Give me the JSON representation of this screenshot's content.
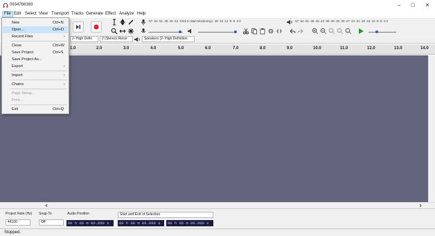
{
  "window": {
    "title": "0934766383",
    "minimize": "–",
    "maximize": "▢",
    "close": "✕"
  },
  "menubar": {
    "items": [
      "File",
      "Edit",
      "Select",
      "View",
      "Transport",
      "Tracks",
      "Generate",
      "Effect",
      "Analyze",
      "Help"
    ]
  },
  "file_menu": {
    "items": [
      {
        "label": "New",
        "shortcut": "Ctrl+N"
      },
      {
        "label": "Open...",
        "shortcut": "Ctrl+O"
      },
      {
        "label": "Recent Files",
        "arrow": "›"
      },
      {
        "label": "Close",
        "shortcut": "Ctrl+W"
      },
      {
        "label": "Save Project",
        "shortcut": "Ctrl+S"
      },
      {
        "label": "Save Project As..."
      },
      {
        "label": "Export",
        "arrow": "›"
      },
      {
        "label": "Import",
        "arrow": "›"
      },
      {
        "label": "Chains",
        "arrow": "›"
      },
      {
        "label": "Page Setup..."
      },
      {
        "label": "Print..."
      },
      {
        "label": "Exit",
        "shortcut": "Ctrl+Q"
      }
    ]
  },
  "toolbar": {
    "record_meter_scale": "-57 -54 -51 -48 -45 -42 -",
    "record_meter_prompt": "Click to Start Monitoring",
    "record_meter_tail": "1 -18 -15 -12  -9  -6  -3  0",
    "playback_meter_scale": "-57 -54 -51 -48 -45 -42 -39 -36 -33 -30 -27 -24 -21 -18 -15 -12  -9  -6  -3  0",
    "device_recording": "2- High Defin",
    "device_channels": "2 (Stereo) Recor",
    "device_playback": "Speakers (2- High Definition"
  },
  "ruler": {
    "ticks": [
      "1.0",
      "2.0",
      "3.0",
      "4.0",
      "5.0",
      "6.0",
      "7.0",
      "8.0",
      "9.0",
      "10.0",
      "11.0",
      "12.0",
      "13.0",
      "14.0"
    ]
  },
  "selection_toolbar": {
    "project_rate_label": "Project Rate (Hz)",
    "project_rate_value": "44100",
    "snap_to_label": "Snap-To",
    "snap_to_value": "Off",
    "audio_position_label": "Audio Position",
    "audio_position_value": "00 h 00 m 00.000 s",
    "selection_mode_value": "Start and End of Selection",
    "selection_start_value": "00 h 00 m 00.000 s",
    "selection_end_value": "00 h 00 m 00.000 s"
  },
  "status": {
    "text": "Stopped."
  },
  "colors": {
    "track_area": "#63657e",
    "menu_highlight": "#cce4f7",
    "record_red": "#d6232a",
    "play_green": "#1aa01a",
    "time_bg": "#1b1b3f",
    "time_fg": "#b7c2ff"
  }
}
